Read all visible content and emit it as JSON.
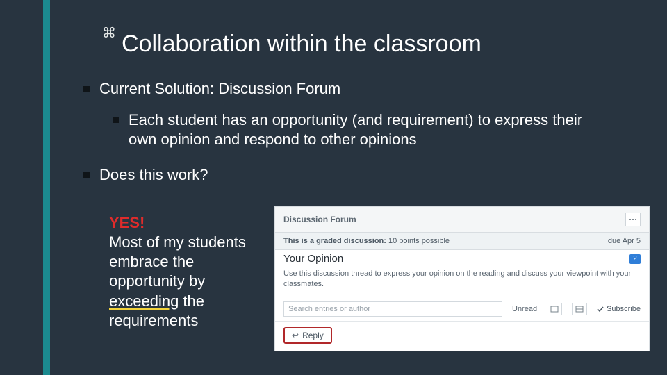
{
  "decorative_mark": "⌘",
  "title": "Collaboration within the classroom",
  "bullets": {
    "b1": "Current Solution: Discussion Forum",
    "b1_1": "Each student has an opportunity (and requirement) to express their own opinion and respond to other opinions",
    "b2": "Does this work?"
  },
  "answer": {
    "yes": "YES!",
    "line1": "Most of my students embrace the opportunity by ",
    "exceeding": "exceeding",
    "line2": " the requirements"
  },
  "embed": {
    "header_title": "Discussion Forum",
    "graded_bold": "This is a graded discussion:",
    "graded_rest": " 10 points possible",
    "due": "due Apr 5",
    "opinion_title": "Your Opinion",
    "badge": "2",
    "description": "Use this discussion thread to express your opinion on the reading and discuss your viewpoint with your classmates.",
    "search_placeholder": "Search entries or author",
    "unread_label": "Unread",
    "subscribe_label": "Subscribe",
    "reply_label": "Reply"
  }
}
